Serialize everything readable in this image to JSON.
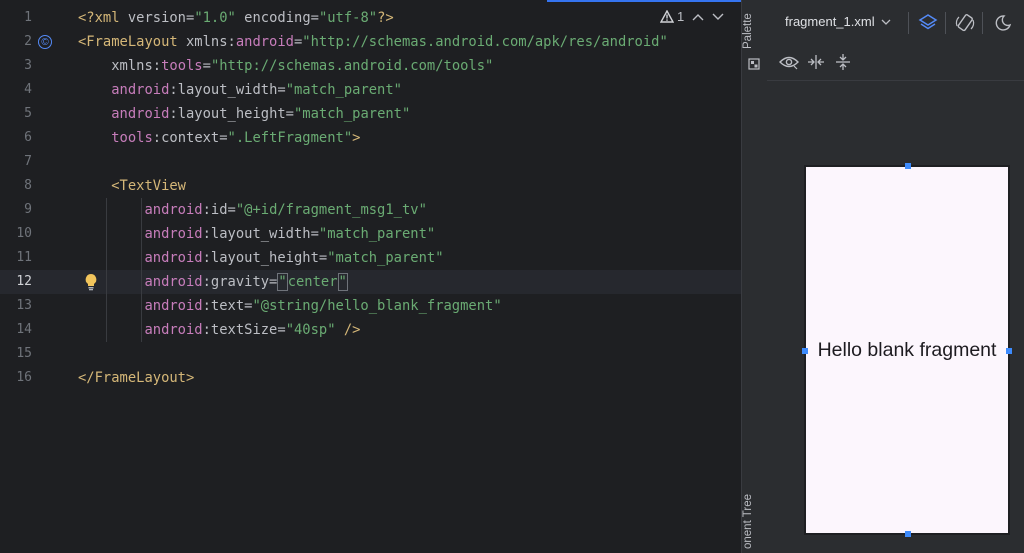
{
  "editor": {
    "line_numbers": [
      "1",
      "2",
      "3",
      "4",
      "5",
      "6",
      "7",
      "8",
      "9",
      "10",
      "11",
      "12",
      "13",
      "14",
      "15",
      "16"
    ],
    "current_line": 12,
    "inspection": {
      "warning_count": "1"
    },
    "lines": [
      [
        {
          "c": "tag",
          "t": "<?xml "
        },
        {
          "c": "attr",
          "t": "version"
        },
        {
          "c": "plain",
          "t": "="
        },
        {
          "c": "str",
          "t": "\"1.0\""
        },
        {
          "c": "plain",
          "t": " "
        },
        {
          "c": "attr",
          "t": "encoding"
        },
        {
          "c": "plain",
          "t": "="
        },
        {
          "c": "str",
          "t": "\"utf-8\""
        },
        {
          "c": "tag",
          "t": "?>"
        }
      ],
      [
        {
          "c": "tag",
          "t": "<FrameLayout "
        },
        {
          "c": "attr",
          "t": "xmlns:"
        },
        {
          "c": "ns",
          "t": "android"
        },
        {
          "c": "plain",
          "t": "="
        },
        {
          "c": "str",
          "t": "\"http://schemas.android.com/apk/res/android\""
        }
      ],
      [
        {
          "c": "plain",
          "t": "    "
        },
        {
          "c": "attr",
          "t": "xmlns:"
        },
        {
          "c": "ns",
          "t": "tools"
        },
        {
          "c": "plain",
          "t": "="
        },
        {
          "c": "str",
          "t": "\"http://schemas.android.com/tools\""
        }
      ],
      [
        {
          "c": "plain",
          "t": "    "
        },
        {
          "c": "ns",
          "t": "android"
        },
        {
          "c": "plain",
          "t": ":layout_width="
        },
        {
          "c": "str",
          "t": "\"match_parent\""
        }
      ],
      [
        {
          "c": "plain",
          "t": "    "
        },
        {
          "c": "ns",
          "t": "android"
        },
        {
          "c": "plain",
          "t": ":layout_height="
        },
        {
          "c": "str",
          "t": "\"match_parent\""
        }
      ],
      [
        {
          "c": "plain",
          "t": "    "
        },
        {
          "c": "ns",
          "t": "tools"
        },
        {
          "c": "plain",
          "t": ":context="
        },
        {
          "c": "str",
          "t": "\".LeftFragment\""
        },
        {
          "c": "tag",
          "t": ">"
        }
      ],
      [],
      [
        {
          "c": "plain",
          "t": "    "
        },
        {
          "c": "tag",
          "t": "<TextView"
        }
      ],
      [
        {
          "c": "plain",
          "t": "        "
        },
        {
          "c": "ns",
          "t": "android"
        },
        {
          "c": "plain",
          "t": ":id="
        },
        {
          "c": "str",
          "t": "\"@+id/fragment_msg1_tv\""
        }
      ],
      [
        {
          "c": "plain",
          "t": "        "
        },
        {
          "c": "ns",
          "t": "android"
        },
        {
          "c": "plain",
          "t": ":layout_width="
        },
        {
          "c": "str",
          "t": "\"match_parent\""
        }
      ],
      [
        {
          "c": "plain",
          "t": "        "
        },
        {
          "c": "ns",
          "t": "android"
        },
        {
          "c": "plain",
          "t": ":layout_height="
        },
        {
          "c": "str",
          "t": "\"match_parent\""
        }
      ],
      [
        {
          "c": "plain",
          "t": "        "
        },
        {
          "c": "ns",
          "t": "android"
        },
        {
          "c": "plain",
          "t": ":gravity="
        },
        {
          "c": "str",
          "t": "\""
        },
        {
          "c": "str",
          "t": "center"
        },
        {
          "c": "str",
          "t": "\""
        }
      ],
      [
        {
          "c": "plain",
          "t": "        "
        },
        {
          "c": "ns",
          "t": "android"
        },
        {
          "c": "plain",
          "t": ":text="
        },
        {
          "c": "str",
          "t": "\"@string/hello_blank_fragment\""
        }
      ],
      [
        {
          "c": "plain",
          "t": "        "
        },
        {
          "c": "ns",
          "t": "android"
        },
        {
          "c": "plain",
          "t": ":textSize="
        },
        {
          "c": "str",
          "t": "\"40sp\""
        },
        {
          "c": "plain",
          "t": " "
        },
        {
          "c": "tag",
          "t": "/>"
        }
      ],
      [],
      [
        {
          "c": "tag",
          "t": "</FrameLayout>"
        }
      ]
    ]
  },
  "side_tabs": {
    "palette": "Palette",
    "component_tree": "onent Tree"
  },
  "design": {
    "file_name": "fragment_1.xml",
    "preview_text": "Hello blank fragment"
  },
  "colors": {
    "accent": "#3574f0",
    "editor_bg": "#1e1f22",
    "panel_bg": "#2b2d30",
    "preview_bg": "#fcf6fd"
  }
}
